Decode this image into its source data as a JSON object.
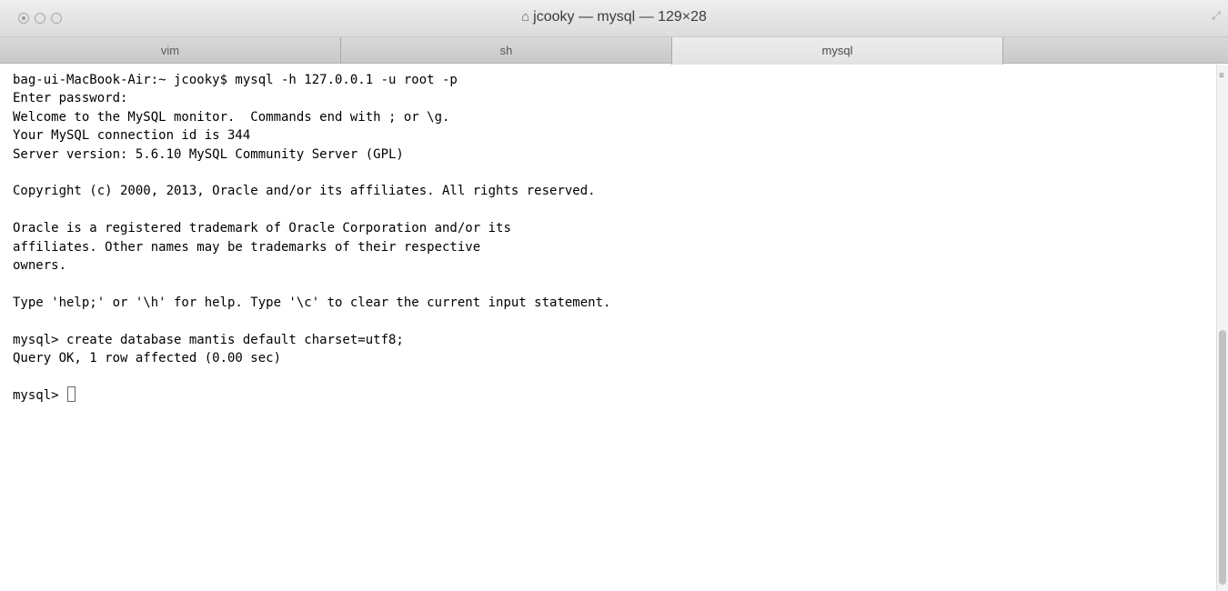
{
  "window": {
    "title": "jcooky — mysql — 129×28",
    "home_icon": "house-icon"
  },
  "tabs": [
    {
      "label": "vim",
      "active": false
    },
    {
      "label": "sh",
      "active": false
    },
    {
      "label": "mysql",
      "active": true
    }
  ],
  "terminal": {
    "lines": [
      "bag-ui-MacBook-Air:~ jcooky$ mysql -h 127.0.0.1 -u root -p",
      "Enter password:",
      "Welcome to the MySQL monitor.  Commands end with ; or \\g.",
      "Your MySQL connection id is 344",
      "Server version: 5.6.10 MySQL Community Server (GPL)",
      "",
      "Copyright (c) 2000, 2013, Oracle and/or its affiliates. All rights reserved.",
      "",
      "Oracle is a registered trademark of Oracle Corporation and/or its",
      "affiliates. Other names may be trademarks of their respective",
      "owners.",
      "",
      "Type 'help;' or '\\h' for help. Type '\\c' to clear the current input statement.",
      "",
      "mysql> create database mantis default charset=utf8;",
      "Query OK, 1 row affected (0.00 sec)",
      ""
    ],
    "prompt": "mysql> "
  }
}
